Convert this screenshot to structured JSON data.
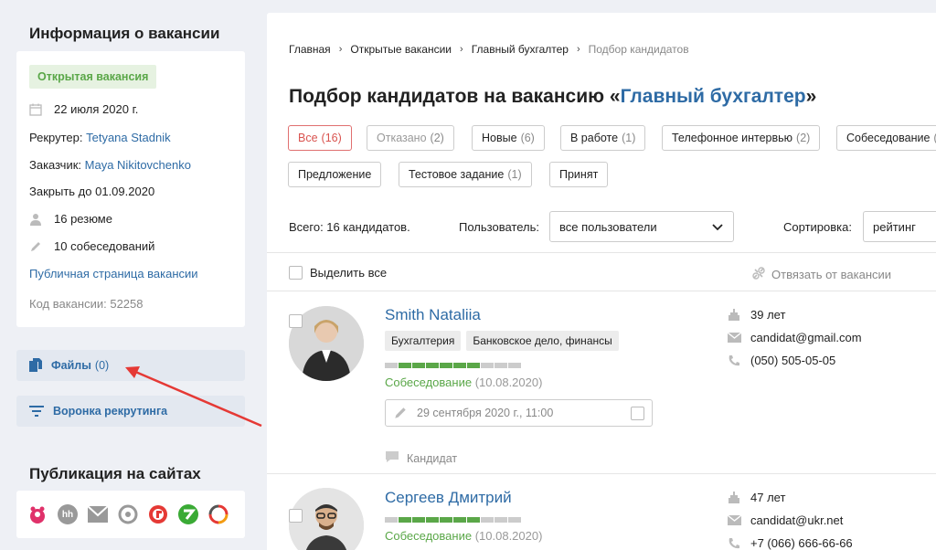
{
  "sidebar": {
    "info_title": "Информация о вакансии",
    "status_badge": "Открытая вакансия",
    "date": "22 июля 2020 г.",
    "recruiter_label": "Рекрутер:",
    "recruiter_name": "Tetyana Stadnik",
    "client_label": "Заказчик:",
    "client_name": "Maya Nikitovchenko",
    "close_until": "Закрыть до 01.09.2020",
    "resumes": "16 резюме",
    "interviews": "10 собеседований",
    "public_page_link": "Публичная страница вакансии",
    "vacancy_code": "Код вакансии: 52258",
    "files_label": "Файлы",
    "files_count": "(0)",
    "funnel_label": "Воронка рекрутинга",
    "publication_title": "Публикация на сайтах",
    "publication_sites": [
      "rabota-icon",
      "hh-icon",
      "mail-icon",
      "target-icon",
      "grc-icon",
      "zp-icon",
      "ring-icon"
    ],
    "hh_text": "hh"
  },
  "breadcrumb": {
    "items": [
      "Главная",
      "Открытые вакансии",
      "Главный бухгалтер"
    ],
    "current": "Подбор кандидатов",
    "sep": "›"
  },
  "page_title": {
    "prefix": "Подбор кандидатов на вакансию «",
    "vacancy": "Главный бухгалтер",
    "suffix": "»"
  },
  "stages": [
    {
      "label": "Все",
      "count": "(16)"
    },
    {
      "label": "Отказано",
      "count": "(2)"
    },
    {
      "label": "Новые",
      "count": "(6)"
    },
    {
      "label": "В работе",
      "count": "(1)"
    },
    {
      "label": "Телефонное интервью",
      "count": "(2)"
    },
    {
      "label": "Собеседование",
      "count": "("
    },
    {
      "label": "Предложение",
      "count": ""
    },
    {
      "label": "Тестовое задание",
      "count": "(1)"
    },
    {
      "label": "Принят",
      "count": ""
    }
  ],
  "filters": {
    "total": "Всего: 16 кандидатов.",
    "user_label": "Пользователь:",
    "user_value": "все пользователи",
    "sort_label": "Сортировка:",
    "sort_value": "рейтинг"
  },
  "list_toolbar": {
    "select_all": "Выделить все",
    "unbind": "Отвязать от вакансии"
  },
  "candidates": [
    {
      "name": "Smith Nataliia",
      "tags": [
        "Бухгалтерия",
        "Банковское дело, финансы"
      ],
      "progress": 0.6,
      "status": "Собеседование",
      "status_date": "(10.08.2020)",
      "event": "29 сентября 2020 г., 11:00",
      "comment": "Кандидат",
      "age": "39 лет",
      "email": "candidat@gmail.com",
      "phone": "(050) 505-05-05"
    },
    {
      "name": "Сергеев Дмитрий",
      "tags": [],
      "progress": 0.6,
      "status": "Собеседование",
      "status_date": "(10.08.2020)",
      "age": "47 лет",
      "email": "candidat@ukr.net",
      "phone": "+7 (066) 666-66-66"
    }
  ],
  "colors": {
    "accent": "#2e6ba5",
    "green": "#5aa748",
    "red_active": "#d9534f",
    "annotation_arrow": "#e53935"
  }
}
